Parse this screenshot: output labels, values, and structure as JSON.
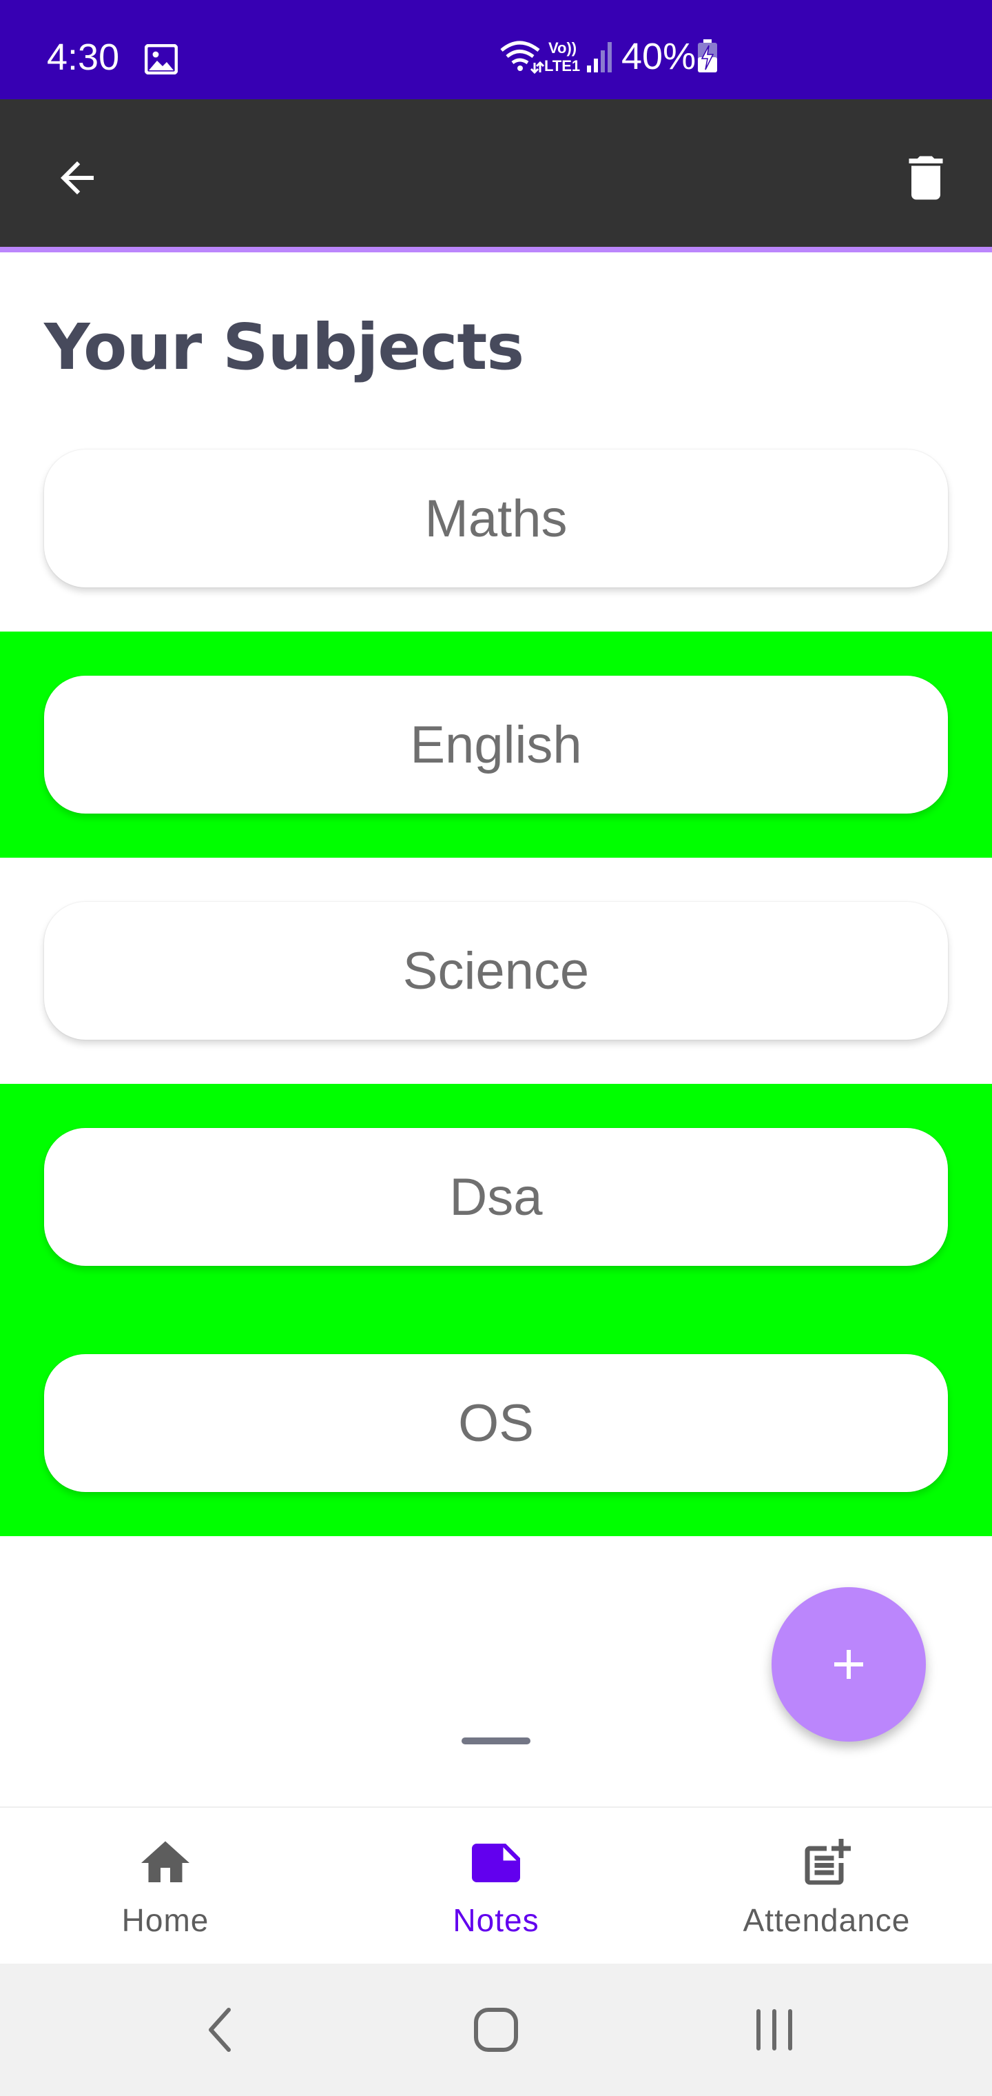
{
  "status_bar": {
    "time": "4:30",
    "battery": "40%",
    "network_label": "Vo)) LTE1"
  },
  "app_bar": {
    "back_icon": "arrow-back-icon",
    "delete_icon": "trash-icon"
  },
  "page": {
    "title": "Your Subjects"
  },
  "subjects": [
    {
      "label": "Maths",
      "highlighted": false
    },
    {
      "label": "English",
      "highlighted": true
    },
    {
      "label": "Science",
      "highlighted": false
    },
    {
      "label": "Dsa",
      "highlighted": true
    },
    {
      "label": "OS",
      "highlighted": true
    }
  ],
  "fab": {
    "icon": "plus-icon"
  },
  "bottom_nav": {
    "items": [
      {
        "label": "Home",
        "icon": "home-icon",
        "active": false
      },
      {
        "label": "Notes",
        "icon": "note-icon",
        "active": true
      },
      {
        "label": "Attendance",
        "icon": "post-add-icon",
        "active": false
      }
    ]
  },
  "colors": {
    "status_bar": "#3700b3",
    "app_bar": "#333333",
    "accent": "#bb86fc",
    "highlight": "#00ff00",
    "active_nav": "#6200ee"
  }
}
